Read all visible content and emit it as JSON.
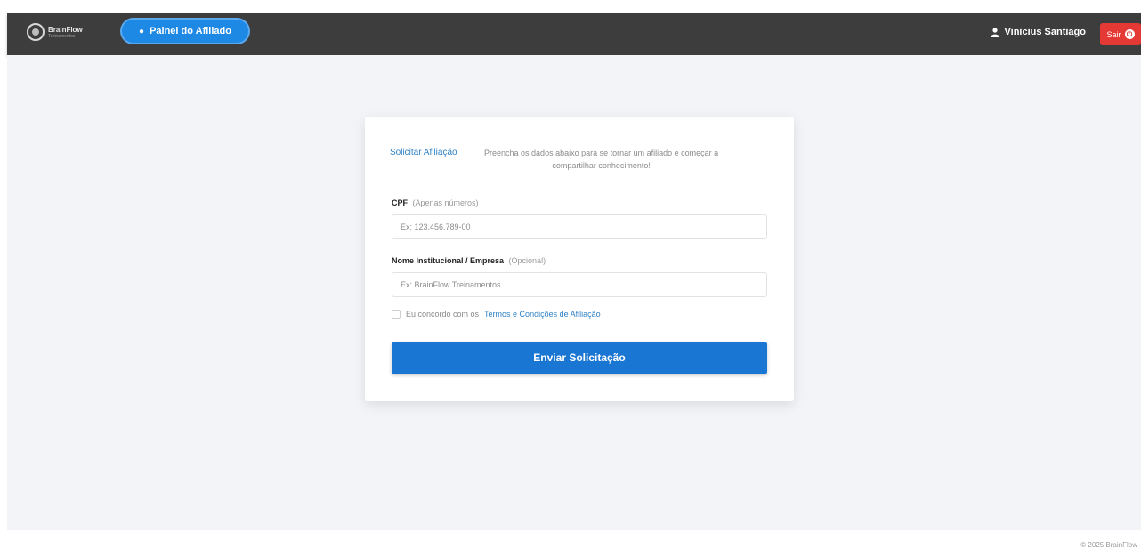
{
  "navbar": {
    "logo_text": "BrainFlow",
    "logo_sub": "Treinamentos",
    "panel_button": "Painel do Afiliado",
    "user_name": "Vinicius Santiago",
    "logout_label": "Sair"
  },
  "form": {
    "title": "Solicitar Afiliação",
    "description": "Preencha os dados abaixo para se tornar um afiliado e começar a compartilhar conhecimento!",
    "cpf_label": "CPF",
    "cpf_hint": "(Apenas números)",
    "cpf_placeholder": "Ex: 123.456.789-00",
    "company_label": "Nome Institucional / Empresa",
    "company_hint": "(Opcional)",
    "company_placeholder": "Ex: BrainFlow Treinamentos",
    "terms_text": "Eu concordo com os",
    "terms_link": "Termos e Condições de Afiliação",
    "submit_label": "Enviar Solicitação"
  },
  "footer": {
    "copyright": "© 2025 BrainFlow"
  },
  "colors": {
    "navbar": "#3d3d3d",
    "accent": "#1976d2",
    "danger": "#e53935",
    "background": "#f2f4f8"
  }
}
